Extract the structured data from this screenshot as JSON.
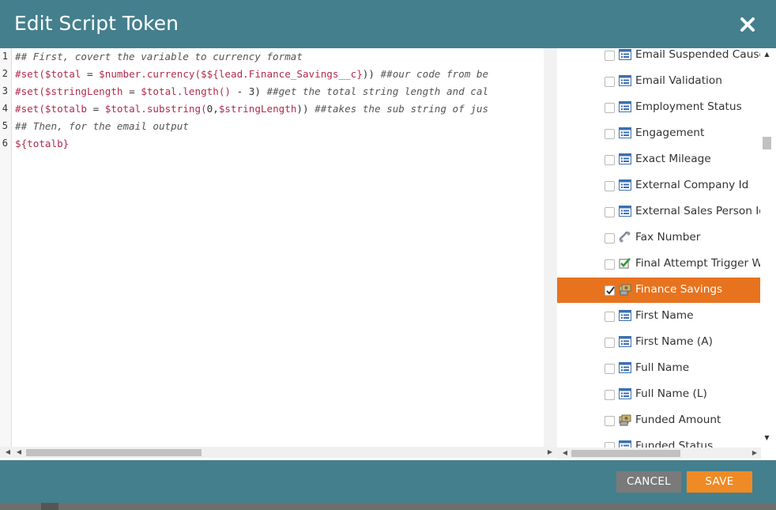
{
  "dialog": {
    "title": "Edit Script Token",
    "close_icon": "close-icon"
  },
  "editor": {
    "lines": [
      {
        "num": "1",
        "parts": [
          {
            "t": "## First, covert the variable to currency format",
            "c": "comment"
          }
        ]
      },
      {
        "num": "2",
        "parts": [
          {
            "t": "#set(",
            "c": "kw"
          },
          {
            "t": "$total",
            "c": "var"
          },
          {
            "t": " = ",
            "c": "plain"
          },
          {
            "t": "$number.currency(",
            "c": "var"
          },
          {
            "t": "$${lead.Finance_Savings__c}",
            "c": "var"
          },
          {
            "t": ")) ",
            "c": "plain"
          },
          {
            "t": "##our code from be",
            "c": "comment"
          }
        ]
      },
      {
        "num": "3",
        "parts": [
          {
            "t": "#set(",
            "c": "kw"
          },
          {
            "t": "$stringLength",
            "c": "var"
          },
          {
            "t": " = ",
            "c": "plain"
          },
          {
            "t": "$total.length()",
            "c": "var"
          },
          {
            "t": " - 3) ",
            "c": "plain"
          },
          {
            "t": "##get the total string length and cal",
            "c": "comment"
          }
        ]
      },
      {
        "num": "4",
        "parts": [
          {
            "t": "#set(",
            "c": "kw"
          },
          {
            "t": "$totalb",
            "c": "var"
          },
          {
            "t": " = ",
            "c": "plain"
          },
          {
            "t": "$total.substring(",
            "c": "var"
          },
          {
            "t": "0,",
            "c": "plain"
          },
          {
            "t": "$stringLength",
            "c": "var"
          },
          {
            "t": ")) ",
            "c": "plain"
          },
          {
            "t": "##takes the sub string of jus",
            "c": "comment"
          }
        ]
      },
      {
        "num": "5",
        "parts": [
          {
            "t": "## Then, for the email output",
            "c": "comment"
          }
        ]
      },
      {
        "num": "6",
        "parts": [
          {
            "t": "${totalb}",
            "c": "var"
          }
        ]
      }
    ]
  },
  "fields": [
    {
      "label": "Email Suspended Cause",
      "icon": "string-field-icon",
      "checked": false,
      "selected": false
    },
    {
      "label": "Email Validation",
      "icon": "string-field-icon",
      "checked": false,
      "selected": false
    },
    {
      "label": "Employment Status",
      "icon": "string-field-icon",
      "checked": false,
      "selected": false
    },
    {
      "label": "Engagement",
      "icon": "string-field-icon",
      "checked": false,
      "selected": false
    },
    {
      "label": "Exact Mileage",
      "icon": "string-field-icon",
      "checked": false,
      "selected": false
    },
    {
      "label": "External Company Id",
      "icon": "string-field-icon",
      "checked": false,
      "selected": false
    },
    {
      "label": "External Sales Person Id",
      "icon": "string-field-icon",
      "checked": false,
      "selected": false
    },
    {
      "label": "Fax Number",
      "icon": "phone-field-icon",
      "checked": false,
      "selected": false
    },
    {
      "label": "Final Attempt Trigger Wo",
      "icon": "boolean-field-icon",
      "checked": false,
      "selected": false
    },
    {
      "label": "Finance Savings",
      "icon": "currency-field-icon",
      "checked": true,
      "selected": true
    },
    {
      "label": "First Name",
      "icon": "string-field-icon",
      "checked": false,
      "selected": false
    },
    {
      "label": "First Name (A)",
      "icon": "string-field-icon",
      "checked": false,
      "selected": false
    },
    {
      "label": "Full Name",
      "icon": "string-field-icon",
      "checked": false,
      "selected": false
    },
    {
      "label": "Full Name (L)",
      "icon": "string-field-icon",
      "checked": false,
      "selected": false
    },
    {
      "label": "Funded Amount",
      "icon": "currency-field-icon",
      "checked": false,
      "selected": false
    },
    {
      "label": "Funded Status",
      "icon": "string-field-icon",
      "checked": false,
      "selected": false
    }
  ],
  "footer": {
    "cancel_label": "CANCEL",
    "save_label": "SAVE"
  },
  "colors": {
    "header_bg": "#447f8d",
    "selected_row": "#e8731e",
    "save_button": "#f08a24",
    "cancel_button": "#7a7a7a"
  }
}
